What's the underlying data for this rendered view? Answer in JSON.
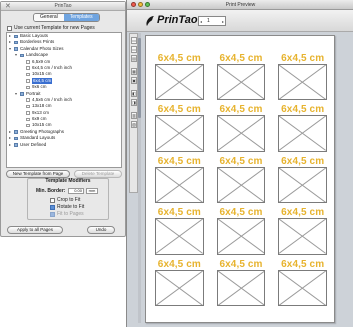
{
  "panel": {
    "title": "PrinTao",
    "tabs": [
      {
        "label": "General"
      },
      {
        "label": "Templates"
      }
    ],
    "use_current_label": "Use current Template for new Pages",
    "tree": [
      {
        "label": "Basic Layouts",
        "level": 0,
        "open": false
      },
      {
        "label": "Borderless Prints",
        "level": 0,
        "open": false
      },
      {
        "label": "Calendar Photo Sizes",
        "level": 0,
        "open": true
      },
      {
        "label": "Landscape",
        "level": 1,
        "open": true
      },
      {
        "label": "6,5x9 cm",
        "level": 2
      },
      {
        "label": "6x4,5 cm / Inch inch",
        "level": 2
      },
      {
        "label": "10x15 cm",
        "level": 2
      },
      {
        "label": "6x4,5 cm",
        "level": 2,
        "selected": true
      },
      {
        "label": "9x6 cm",
        "level": 2
      },
      {
        "label": "Portrait",
        "level": 1,
        "open": true
      },
      {
        "label": "4,5x6 cm / Inch inch",
        "level": 2
      },
      {
        "label": "13x18 cm",
        "level": 2
      },
      {
        "label": "9x13 cm",
        "level": 2
      },
      {
        "label": "6x9 cm",
        "level": 2
      },
      {
        "label": "10x15 cm",
        "level": 2
      },
      {
        "label": "Greeting Photographs",
        "level": 0,
        "open": false
      },
      {
        "label": "Standard Layouts",
        "level": 0,
        "open": false
      },
      {
        "label": "User Defined",
        "level": 0,
        "open": false
      }
    ],
    "new_template_label": "New Template from Page",
    "delete_template_label": "Delete Template",
    "modifiers": {
      "title": "Template Modifiers",
      "min_border_label": "Min. Border:",
      "min_border_value": "0.00",
      "min_border_unit": "mm",
      "crop_label": "Crop to Fit",
      "rotate_label": "Rotate to Fit",
      "fit_pages_label": "Fit to Pages"
    },
    "apply_label": "Apply to all Pages",
    "undo_label": "Undo"
  },
  "preview": {
    "window_title": "Print Preview",
    "logo_text": "PrinTao",
    "page_number": "1",
    "tile_label": "6x4,5 cm",
    "rows": 5,
    "cols": 3
  },
  "colors": {
    "accent_label": "#e7b32e",
    "selection": "#3a6fd0",
    "close_light": "#f05a4e",
    "minimize_light": "#f3bd3a",
    "zoom_light": "#5fc453"
  },
  "icons": {
    "window_close": "close-light-icon",
    "window_minimize": "minimize-light-icon",
    "window_zoom": "zoom-light-icon",
    "logo": "printao-logo-icon",
    "placeholder": "image-placeholder-icon",
    "folder": "folder-icon",
    "disclosure": "disclosure-triangle-icon"
  }
}
